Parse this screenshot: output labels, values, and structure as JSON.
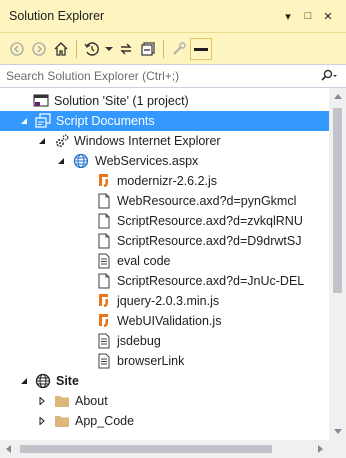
{
  "window": {
    "title": "Solution Explorer",
    "pin_glyph": "▾",
    "pushpin_glyph": "□",
    "close_glyph": "✕"
  },
  "toolbar": {
    "buttons": [
      "back-icon",
      "forward-icon",
      "home-icon",
      "history-icon",
      "dropdown-icon",
      "sync-icon",
      "collapse-all-icon",
      "properties-icon",
      "preview-icon"
    ]
  },
  "search": {
    "placeholder": "Search Solution Explorer (Ctrl+;)"
  },
  "tree": {
    "items": [
      {
        "label": "Solution 'Site' (1 project)",
        "icon": "solution-icon"
      },
      {
        "label": "Script Documents",
        "icon": "script-documents-icon",
        "selected": true
      },
      {
        "label": "Windows Internet Explorer",
        "icon": "browser-gears-icon"
      },
      {
        "label": "WebServices.aspx",
        "icon": "globe-icon"
      },
      {
        "label": "modernizr-2.6.2.js",
        "icon": "js-file-icon"
      },
      {
        "label": "WebResource.axd?d=pynGkmcl",
        "icon": "blank-file-icon"
      },
      {
        "label": "ScriptResource.axd?d=zvkqlRNU",
        "icon": "blank-file-icon"
      },
      {
        "label": "ScriptResource.axd?d=D9drwtSJ",
        "icon": "blank-file-icon"
      },
      {
        "label": "eval code",
        "icon": "text-file-icon"
      },
      {
        "label": "ScriptResource.axd?d=JnUc-DEL",
        "icon": "blank-file-icon"
      },
      {
        "label": "jquery-2.0.3.min.js",
        "icon": "js-file-icon"
      },
      {
        "label": "WebUIValidation.js",
        "icon": "js-file-icon"
      },
      {
        "label": "jsdebug",
        "icon": "text-file-icon"
      },
      {
        "label": "browserLink",
        "icon": "text-file-icon"
      },
      {
        "label": "Site",
        "icon": "globe-icon"
      },
      {
        "label": "About",
        "icon": "folder-icon"
      },
      {
        "label": "App_Code",
        "icon": "folder-icon"
      }
    ]
  },
  "colors": {
    "header_bg": "#fdf4bf",
    "selection": "#3399ff",
    "js_icon": "#e8751a",
    "folder": "#dcb67a"
  }
}
